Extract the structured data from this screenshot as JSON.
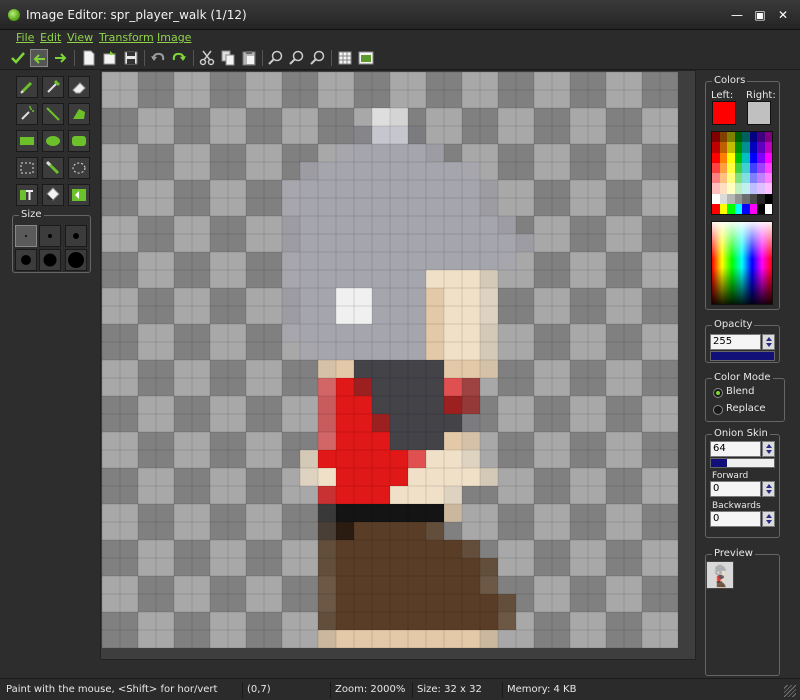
{
  "window": {
    "title": "Image Editor: spr_player_walk (1/12)",
    "min_glyph": "—",
    "max_glyph": "▣",
    "close_glyph": "✕"
  },
  "menu": [
    "File",
    "Edit",
    "View",
    "Transform",
    "Image"
  ],
  "toolbar_icons": [
    "check-icon",
    "undo-green-icon",
    "redo-green-icon",
    "new-icon",
    "load-icon",
    "save-icon",
    "undo-icon",
    "redo-icon",
    "cut-icon",
    "copy-icon",
    "paste-icon",
    "zoom-in-icon",
    "zoom-reset-icon",
    "zoom-out-icon",
    "grid-icon",
    "image-settings-icon"
  ],
  "tools": [
    "pencil-tool-icon",
    "color-picker-tool-icon",
    "eraser-tool-icon",
    "spray-tool-icon",
    "line-tool-icon",
    "polygon-tool-icon",
    "rectangle-tool-icon",
    "ellipse-tool-icon",
    "rounded-rect-tool-icon",
    "select-rect-tool-icon",
    "magic-wand-tool-icon",
    "select-ellipse-tool-icon",
    "text-tool-icon",
    "fill-tool-icon",
    "replace-color-tool-icon"
  ],
  "size": {
    "label": "Size",
    "selected": 0
  },
  "colors": {
    "label": "Colors",
    "left_label": "Left:",
    "right_label": "Right:",
    "left_color": "#ff0000",
    "right_color": "#c0c0c0"
  },
  "opacity": {
    "label": "Opacity",
    "value": "255",
    "level": 1.0
  },
  "color_mode": {
    "label": "Color Mode",
    "options": [
      "Blend",
      "Replace"
    ],
    "selected": "Blend"
  },
  "onion_skin": {
    "label": "Onion Skin",
    "value": "64",
    "level": 0.25,
    "forward_label": "Forward",
    "forward_value": "0",
    "backwards_label": "Backwards",
    "backwards_value": "0"
  },
  "preview": {
    "label": "Preview"
  },
  "status": {
    "hint": "Paint with the mouse, <Shift> for hor/vert",
    "position": "(0,7)",
    "zoom": "Zoom: 2000%",
    "size": "Size: 32 x 32",
    "memory": "Memory: 4 KB"
  },
  "sprite": {
    "grid": [
      32,
      32
    ],
    "colors": {
      "g": "#a5a5ad",
      "G": "#c6c6ce",
      "w": "#f0f0f0",
      "k": "#434348",
      "r": "#e01818",
      "R": "#9c2020",
      "p": "#e05050",
      "s": "#f0e0c8",
      "S": "#e3c9a8",
      "b": "#5a3d26",
      "B": "#2b1c12",
      "d": "#141414",
      "h": "#7a7a80"
    }
  }
}
